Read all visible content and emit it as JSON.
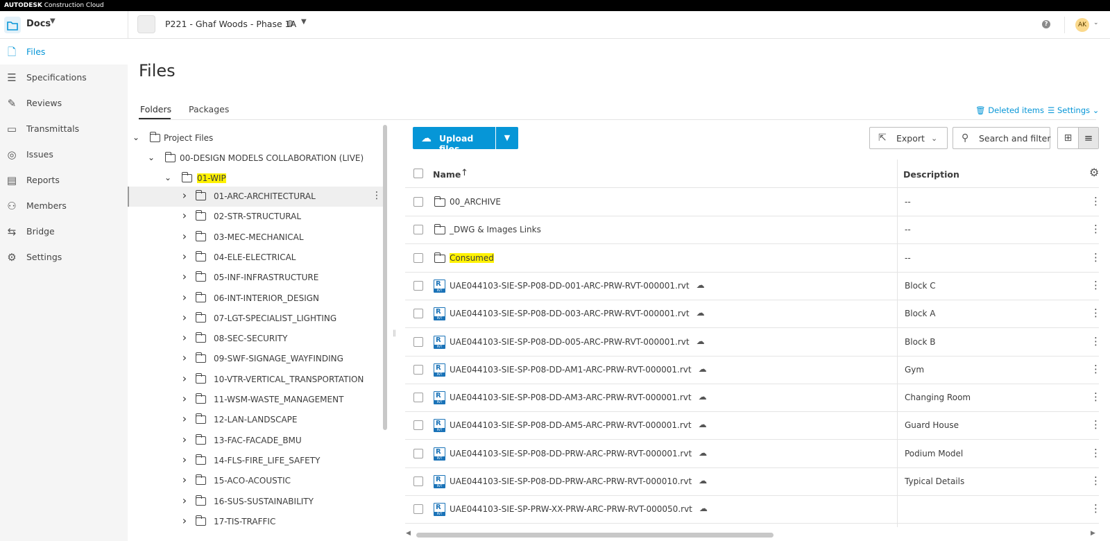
{
  "brand": {
    "prefix": "AUTODESK",
    "product": "Construction Cloud"
  },
  "header": {
    "app_name": "Docs",
    "project_name": "P221 - Ghaf Woods - Phase 1A",
    "help_label": "?",
    "avatar_initials": "AK"
  },
  "sidebar": {
    "items": [
      {
        "label": "Files",
        "icon": "file-icon",
        "glyph": "🗋",
        "active": true
      },
      {
        "label": "Specifications",
        "icon": "specifications-icon",
        "glyph": "☰"
      },
      {
        "label": "Reviews",
        "icon": "reviews-icon",
        "glyph": "✎"
      },
      {
        "label": "Transmittals",
        "icon": "transmittals-icon",
        "glyph": "▭"
      },
      {
        "label": "Issues",
        "icon": "issues-icon",
        "glyph": "◎"
      },
      {
        "label": "Reports",
        "icon": "reports-icon",
        "glyph": "▤"
      },
      {
        "label": "Members",
        "icon": "members-icon",
        "glyph": "⚇"
      },
      {
        "label": "Bridge",
        "icon": "bridge-icon",
        "glyph": "⇆"
      },
      {
        "label": "Settings",
        "icon": "settings-gear-icon",
        "glyph": "⚙"
      }
    ]
  },
  "page": {
    "title": "Files",
    "tabs": [
      "Folders",
      "Packages"
    ],
    "deleted_items": "Deleted items",
    "settings": "Settings"
  },
  "tree": {
    "project_files": "Project Files",
    "design_models": "00-DESIGN MODELS COLLABORATION (LIVE)",
    "wip": "01-WIP",
    "folders": [
      "01-ARC-ARCHITECTURAL",
      "02-STR-STRUCTURAL",
      "03-MEC-MECHANICAL",
      "04-ELE-ELECTRICAL",
      "05-INF-INFRASTRUCTURE",
      "06-INT-INTERIOR_DESIGN",
      "07-LGT-SPECIALIST_LIGHTING",
      "08-SEC-SECURITY",
      "09-SWF-SIGNAGE_WAYFINDING",
      "10-VTR-VERTICAL_TRANSPORTATION",
      "11-WSM-WASTE_MANAGEMENT",
      "12-LAN-LANDSCAPE",
      "13-FAC-FACADE_BMU",
      "14-FLS-FIRE_LIFE_SAFETY",
      "15-ACO-ACOUSTIC",
      "16-SUS-SUSTAINABILITY",
      "17-TIS-TRAFFIC"
    ]
  },
  "toolbar": {
    "upload_label": "Upload files",
    "export_label": "Export",
    "search_label": "Search and filter"
  },
  "table": {
    "col_name": "Name",
    "col_desc": "Description",
    "rows": [
      {
        "name": "00_ARCHIVE",
        "desc": "--",
        "type": "folder"
      },
      {
        "name": "_DWG & Images Links",
        "desc": "--",
        "type": "folder"
      },
      {
        "name": "Consumed",
        "desc": "--",
        "type": "folder",
        "highlight": true
      },
      {
        "name": "UAE044103-SIE-SP-P08-DD-001-ARC-PRW-RVT-000001.rvt",
        "desc": "Block C",
        "type": "rvt"
      },
      {
        "name": "UAE044103-SIE-SP-P08-DD-003-ARC-PRW-RVT-000001.rvt",
        "desc": "Block A",
        "type": "rvt"
      },
      {
        "name": "UAE044103-SIE-SP-P08-DD-005-ARC-PRW-RVT-000001.rvt",
        "desc": "Block B",
        "type": "rvt"
      },
      {
        "name": "UAE044103-SIE-SP-P08-DD-AM1-ARC-PRW-RVT-000001.rvt",
        "desc": "Gym",
        "type": "rvt"
      },
      {
        "name": "UAE044103-SIE-SP-P08-DD-AM3-ARC-PRW-RVT-000001.rvt",
        "desc": "Changing Room",
        "type": "rvt"
      },
      {
        "name": "UAE044103-SIE-SP-P08-DD-AM5-ARC-PRW-RVT-000001.rvt",
        "desc": "Guard House",
        "type": "rvt"
      },
      {
        "name": "UAE044103-SIE-SP-P08-DD-PRW-ARC-PRW-RVT-000001.rvt",
        "desc": "Podium Model",
        "type": "rvt"
      },
      {
        "name": "UAE044103-SIE-SP-P08-DD-PRW-ARC-PRW-RVT-000010.rvt",
        "desc": "Typical Details",
        "type": "rvt"
      },
      {
        "name": "UAE044103-SIE-SP-PRW-XX-PRW-ARC-PRW-RVT-000050.rvt",
        "desc": "",
        "type": "rvt"
      }
    ]
  },
  "colors": {
    "accent": "#0696d7",
    "highlight": "#fff200"
  }
}
